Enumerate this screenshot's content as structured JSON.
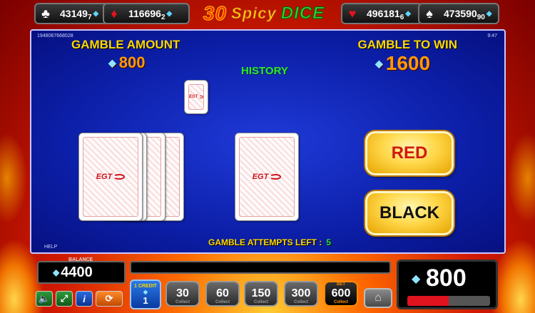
{
  "jackpots": [
    {
      "suit": "♣",
      "amount": "43149",
      "sub": "7"
    },
    {
      "suit": "♦",
      "amount": "116696",
      "sub": "2"
    },
    {
      "suit": "♥",
      "amount": "496181",
      "sub": "6"
    },
    {
      "suit": "♠",
      "amount": "473590",
      "sub": "90"
    }
  ],
  "logo": {
    "number": "30",
    "spicy": "Spicy",
    "dice": "DICE"
  },
  "panel": {
    "id": "1948067668028",
    "clock": "9:47",
    "help": "HELP",
    "gamble_amount_label": "GAMBLE AMOUNT",
    "gamble_amount": "800",
    "gamble_to_win_label": "GAMBLE TO WIN",
    "gamble_to_win": "1600",
    "history_label": "HISTORY",
    "card_brand": "EGT",
    "red_button": "RED",
    "black_button": "BLACK",
    "attempts_label": "GAMBLE ATTEMPTS LEFT :",
    "attempts_left": "5"
  },
  "bottom": {
    "balance_label": "BALANCE",
    "balance": "4400",
    "credit_label": "1 CREDIT",
    "credit_value": "1",
    "bets": [
      {
        "value": "30",
        "sub": "Collect"
      },
      {
        "value": "60",
        "sub": "Collect"
      },
      {
        "value": "150",
        "sub": "Collect"
      },
      {
        "value": "300",
        "sub": "Collect"
      },
      {
        "value": "600",
        "label": "BET",
        "sub": "Collect"
      }
    ],
    "win": "800",
    "win_bar_fraction": 0.5
  },
  "colors": {
    "accent": "#ffd800",
    "win_green": "#2ee82e",
    "red": "#d21a10"
  },
  "icons": [
    "club-icon",
    "diamond-icon",
    "heart-icon",
    "spade-icon",
    "sound-icon",
    "fullscreen-icon",
    "info-icon",
    "autoplay-icon",
    "home-icon"
  ]
}
